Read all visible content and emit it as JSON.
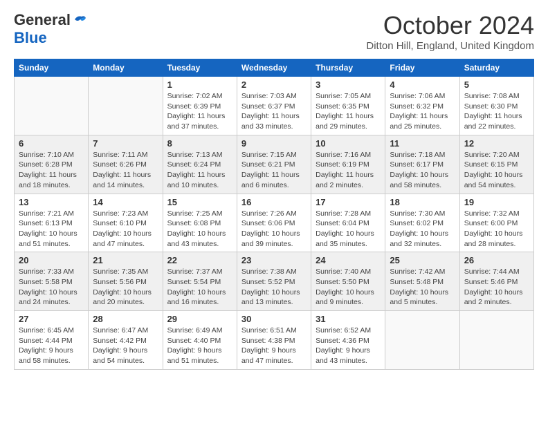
{
  "header": {
    "logo_line1": "General",
    "logo_line2": "Blue",
    "month_title": "October 2024",
    "location": "Ditton Hill, England, United Kingdom"
  },
  "weekdays": [
    "Sunday",
    "Monday",
    "Tuesday",
    "Wednesday",
    "Thursday",
    "Friday",
    "Saturday"
  ],
  "weeks": [
    [
      {
        "day": "",
        "info": ""
      },
      {
        "day": "",
        "info": ""
      },
      {
        "day": "1",
        "info": "Sunrise: 7:02 AM\nSunset: 6:39 PM\nDaylight: 11 hours and 37 minutes."
      },
      {
        "day": "2",
        "info": "Sunrise: 7:03 AM\nSunset: 6:37 PM\nDaylight: 11 hours and 33 minutes."
      },
      {
        "day": "3",
        "info": "Sunrise: 7:05 AM\nSunset: 6:35 PM\nDaylight: 11 hours and 29 minutes."
      },
      {
        "day": "4",
        "info": "Sunrise: 7:06 AM\nSunset: 6:32 PM\nDaylight: 11 hours and 25 minutes."
      },
      {
        "day": "5",
        "info": "Sunrise: 7:08 AM\nSunset: 6:30 PM\nDaylight: 11 hours and 22 minutes."
      }
    ],
    [
      {
        "day": "6",
        "info": "Sunrise: 7:10 AM\nSunset: 6:28 PM\nDaylight: 11 hours and 18 minutes."
      },
      {
        "day": "7",
        "info": "Sunrise: 7:11 AM\nSunset: 6:26 PM\nDaylight: 11 hours and 14 minutes."
      },
      {
        "day": "8",
        "info": "Sunrise: 7:13 AM\nSunset: 6:24 PM\nDaylight: 11 hours and 10 minutes."
      },
      {
        "day": "9",
        "info": "Sunrise: 7:15 AM\nSunset: 6:21 PM\nDaylight: 11 hours and 6 minutes."
      },
      {
        "day": "10",
        "info": "Sunrise: 7:16 AM\nSunset: 6:19 PM\nDaylight: 11 hours and 2 minutes."
      },
      {
        "day": "11",
        "info": "Sunrise: 7:18 AM\nSunset: 6:17 PM\nDaylight: 10 hours and 58 minutes."
      },
      {
        "day": "12",
        "info": "Sunrise: 7:20 AM\nSunset: 6:15 PM\nDaylight: 10 hours and 54 minutes."
      }
    ],
    [
      {
        "day": "13",
        "info": "Sunrise: 7:21 AM\nSunset: 6:13 PM\nDaylight: 10 hours and 51 minutes."
      },
      {
        "day": "14",
        "info": "Sunrise: 7:23 AM\nSunset: 6:10 PM\nDaylight: 10 hours and 47 minutes."
      },
      {
        "day": "15",
        "info": "Sunrise: 7:25 AM\nSunset: 6:08 PM\nDaylight: 10 hours and 43 minutes."
      },
      {
        "day": "16",
        "info": "Sunrise: 7:26 AM\nSunset: 6:06 PM\nDaylight: 10 hours and 39 minutes."
      },
      {
        "day": "17",
        "info": "Sunrise: 7:28 AM\nSunset: 6:04 PM\nDaylight: 10 hours and 35 minutes."
      },
      {
        "day": "18",
        "info": "Sunrise: 7:30 AM\nSunset: 6:02 PM\nDaylight: 10 hours and 32 minutes."
      },
      {
        "day": "19",
        "info": "Sunrise: 7:32 AM\nSunset: 6:00 PM\nDaylight: 10 hours and 28 minutes."
      }
    ],
    [
      {
        "day": "20",
        "info": "Sunrise: 7:33 AM\nSunset: 5:58 PM\nDaylight: 10 hours and 24 minutes."
      },
      {
        "day": "21",
        "info": "Sunrise: 7:35 AM\nSunset: 5:56 PM\nDaylight: 10 hours and 20 minutes."
      },
      {
        "day": "22",
        "info": "Sunrise: 7:37 AM\nSunset: 5:54 PM\nDaylight: 10 hours and 16 minutes."
      },
      {
        "day": "23",
        "info": "Sunrise: 7:38 AM\nSunset: 5:52 PM\nDaylight: 10 hours and 13 minutes."
      },
      {
        "day": "24",
        "info": "Sunrise: 7:40 AM\nSunset: 5:50 PM\nDaylight: 10 hours and 9 minutes."
      },
      {
        "day": "25",
        "info": "Sunrise: 7:42 AM\nSunset: 5:48 PM\nDaylight: 10 hours and 5 minutes."
      },
      {
        "day": "26",
        "info": "Sunrise: 7:44 AM\nSunset: 5:46 PM\nDaylight: 10 hours and 2 minutes."
      }
    ],
    [
      {
        "day": "27",
        "info": "Sunrise: 6:45 AM\nSunset: 4:44 PM\nDaylight: 9 hours and 58 minutes."
      },
      {
        "day": "28",
        "info": "Sunrise: 6:47 AM\nSunset: 4:42 PM\nDaylight: 9 hours and 54 minutes."
      },
      {
        "day": "29",
        "info": "Sunrise: 6:49 AM\nSunset: 4:40 PM\nDaylight: 9 hours and 51 minutes."
      },
      {
        "day": "30",
        "info": "Sunrise: 6:51 AM\nSunset: 4:38 PM\nDaylight: 9 hours and 47 minutes."
      },
      {
        "day": "31",
        "info": "Sunrise: 6:52 AM\nSunset: 4:36 PM\nDaylight: 9 hours and 43 minutes."
      },
      {
        "day": "",
        "info": ""
      },
      {
        "day": "",
        "info": ""
      }
    ]
  ]
}
